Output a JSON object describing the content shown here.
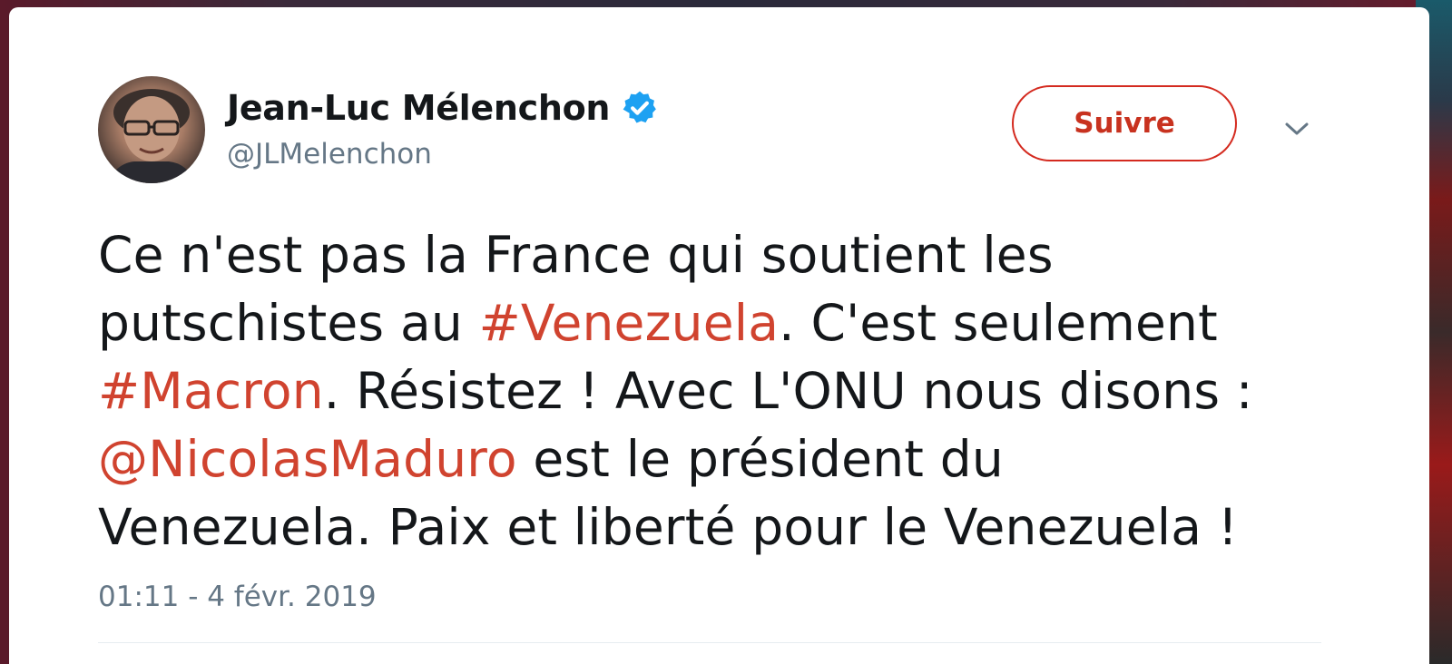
{
  "author": {
    "name": "Jean-Luc Mélenchon",
    "handle": "@JLMelenchon",
    "verified": true
  },
  "actions": {
    "follow_label": "Suivre",
    "menu_icon": "chevron-down-icon"
  },
  "tweet": {
    "lines": [
      [
        {
          "text": "Ce n'est pas la France qui soutient les",
          "type": "text"
        }
      ],
      [
        {
          "text": "putschistes au ",
          "type": "text"
        },
        {
          "text": "#Venezuela",
          "type": "hashtag"
        },
        {
          "text": ". C'est seulement",
          "type": "text"
        }
      ],
      [
        {
          "text": "#Macron",
          "type": "hashtag"
        },
        {
          "text": ". Résistez ! Avec L'ONU nous disons :",
          "type": "text"
        }
      ],
      [
        {
          "text": "@NicolasMaduro",
          "type": "mention"
        },
        {
          "text": " est le président du",
          "type": "text"
        }
      ],
      [
        {
          "text": "Venezuela. Paix et liberté pour le Venezuela !",
          "type": "text"
        }
      ]
    ],
    "timestamp": "01:11 - 4 févr. 2019"
  },
  "colors": {
    "link": "#d0432f",
    "follow": "#c8321f",
    "verified_badge": "#1da1f2",
    "secondary_text": "#657786",
    "primary_text": "#14171a"
  }
}
